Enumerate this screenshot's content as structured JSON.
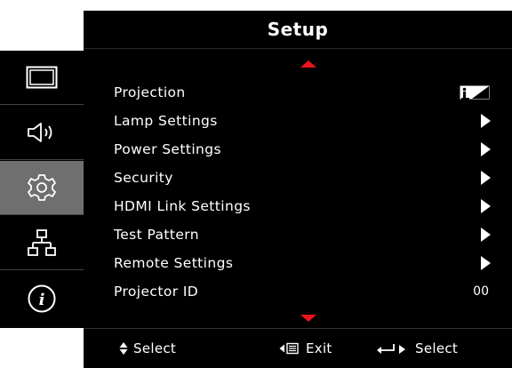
{
  "header": {
    "title": "Setup"
  },
  "sidebar": {
    "items": [
      {
        "id": "display",
        "icon": "display-icon",
        "active": false
      },
      {
        "id": "audio",
        "icon": "speaker-icon",
        "active": false
      },
      {
        "id": "setup",
        "icon": "gear-icon",
        "active": true
      },
      {
        "id": "network",
        "icon": "network-icon",
        "active": false
      },
      {
        "id": "info",
        "icon": "info-icon",
        "active": false
      }
    ]
  },
  "menu": {
    "items": [
      {
        "label": "Projection",
        "control": "projection-icon"
      },
      {
        "label": "Lamp Settings",
        "control": "submenu-arrow"
      },
      {
        "label": "Power Settings",
        "control": "submenu-arrow"
      },
      {
        "label": "Security",
        "control": "submenu-arrow"
      },
      {
        "label": "HDMI Link Settings",
        "control": "submenu-arrow"
      },
      {
        "label": "Test Pattern",
        "control": "submenu-arrow"
      },
      {
        "label": "Remote Settings",
        "control": "submenu-arrow"
      },
      {
        "label": "Projector ID",
        "control": "value",
        "value": "00"
      }
    ],
    "accent_color": "#e8141d"
  },
  "footer": {
    "select_label": "Select",
    "exit_label": "Exit",
    "enter_label": "Select"
  }
}
